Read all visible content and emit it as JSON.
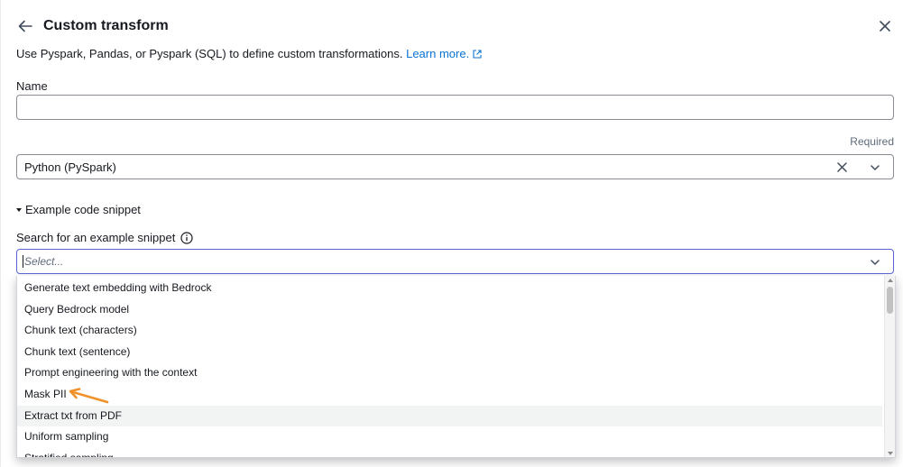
{
  "header": {
    "title": "Custom transform"
  },
  "description": {
    "text": "Use Pyspark, Pandas, or Pyspark (SQL) to define custom transformations.",
    "link_text": "Learn more."
  },
  "name_field": {
    "label": "Name",
    "value": "",
    "placeholder": ""
  },
  "language": {
    "required_text": "Required",
    "selected": "Python (PySpark)"
  },
  "example_snippet": {
    "expander_label": "Example code snippet",
    "search_label": "Search for an example snippet",
    "placeholder": "Select...",
    "options": [
      "Generate text embedding with Bedrock",
      "Query Bedrock model",
      "Chunk text (characters)",
      "Chunk text (sentence)",
      "Prompt engineering with the context",
      "Mask PII",
      "Extract txt from PDF",
      "Uniform sampling",
      "Stratified sampling"
    ],
    "hovered_option": "Extract txt from PDF"
  },
  "annotation": {
    "arrow_target": "Mask PII",
    "arrow_color": "#f0922b"
  },
  "colors": {
    "link": "#0972d3",
    "focus_border": "#5b66d6",
    "text": "#16191f",
    "muted": "#5f6b7a"
  },
  "icons": {
    "back": "arrow-left-icon",
    "close": "close-icon",
    "external": "external-link-icon",
    "clear": "clear-x-icon",
    "dropdown": "chevron-down-icon",
    "info": "info-icon",
    "expander": "caret-down-icon"
  }
}
